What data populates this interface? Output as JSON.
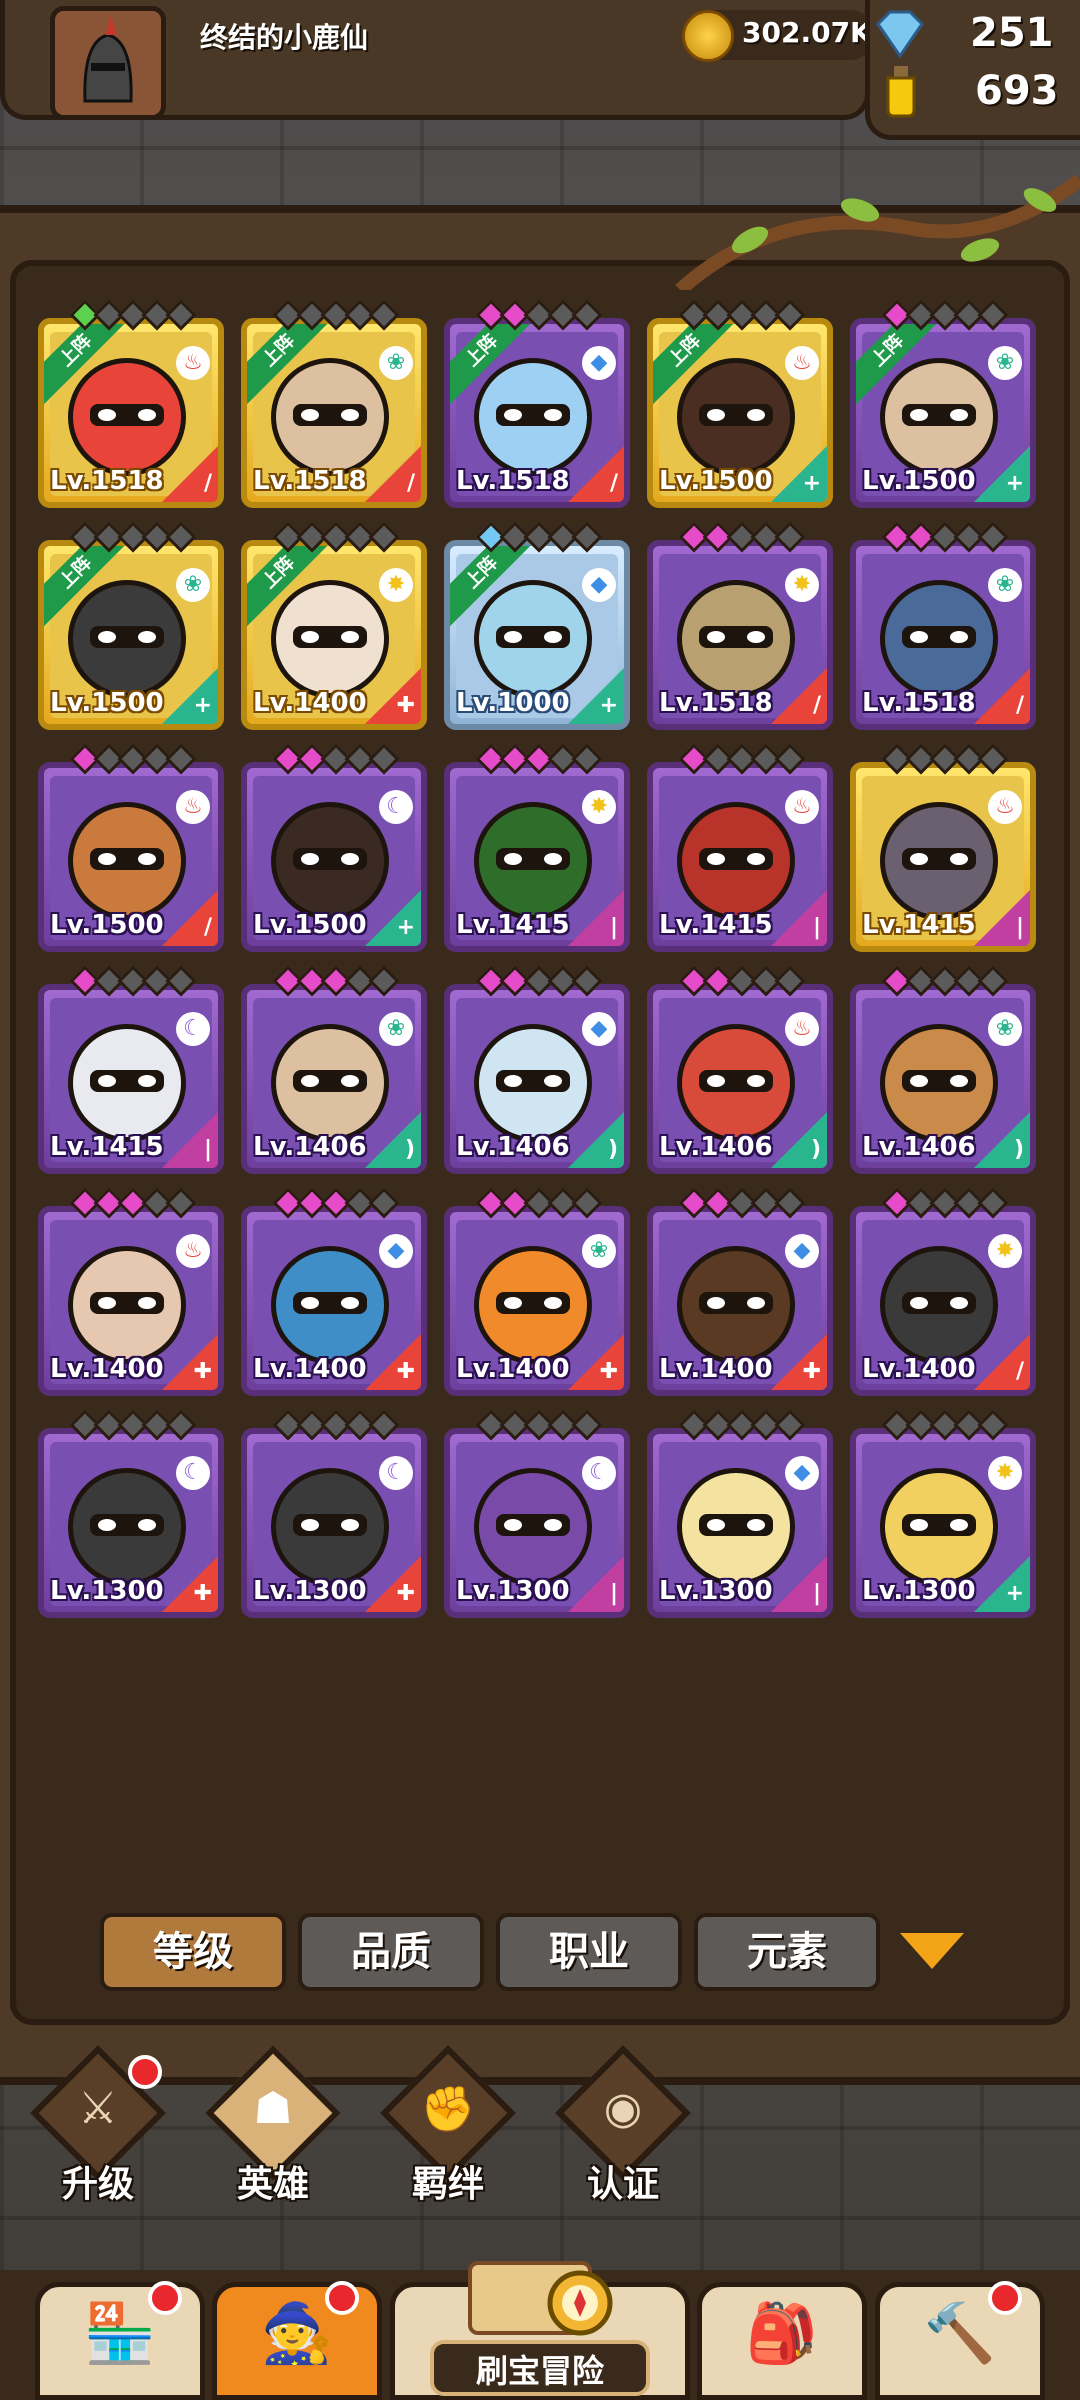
{
  "player": {
    "name": "终结的小鹿仙"
  },
  "resources": {
    "gold": "302.07K",
    "diamonds": "251",
    "potions": "693"
  },
  "heroes": [
    {
      "level": "Lv.1518",
      "rarity": "gold",
      "deployed": true,
      "deployed_label": "上阵",
      "element": "fire",
      "role": "sword",
      "stars": [
        "green",
        "gray",
        "gray",
        "gray",
        "gray"
      ]
    },
    {
      "level": "Lv.1518",
      "rarity": "gold",
      "deployed": true,
      "deployed_label": "上阵",
      "element": "wind",
      "role": "sword",
      "stars": [
        "gray",
        "gray",
        "gray",
        "gray",
        "gray"
      ]
    },
    {
      "level": "Lv.1518",
      "rarity": "purple",
      "deployed": true,
      "deployed_label": "上阵",
      "element": "water",
      "role": "sword",
      "stars": [
        "pink",
        "pink",
        "gray",
        "gray",
        "gray"
      ]
    },
    {
      "level": "Lv.1500",
      "rarity": "gold",
      "deployed": true,
      "deployed_label": "上阵",
      "element": "fire",
      "role": "shield",
      "stars": [
        "gray",
        "gray",
        "gray",
        "gray",
        "gray"
      ]
    },
    {
      "level": "Lv.1500",
      "rarity": "purple",
      "deployed": true,
      "deployed_label": "上阵",
      "element": "wind",
      "role": "shield",
      "stars": [
        "pink",
        "gray",
        "gray",
        "gray",
        "gray"
      ]
    },
    {
      "level": "Lv.1500",
      "rarity": "gold",
      "deployed": true,
      "deployed_label": "上阵",
      "element": "wind",
      "role": "shield",
      "stars": [
        "gray",
        "gray",
        "gray",
        "gray",
        "gray"
      ]
    },
    {
      "level": "Lv.1400",
      "rarity": "gold",
      "deployed": true,
      "deployed_label": "上阵",
      "element": "light",
      "role": "cross",
      "stars": [
        "gray",
        "gray",
        "gray",
        "gray",
        "gray"
      ]
    },
    {
      "level": "Lv.1000",
      "rarity": "silver",
      "deployed": true,
      "deployed_label": "上阵",
      "element": "water",
      "role": "shield",
      "stars": [
        "blue",
        "gray",
        "gray",
        "gray",
        "gray"
      ]
    },
    {
      "level": "Lv.1518",
      "rarity": "purple",
      "deployed": false,
      "element": "light",
      "role": "sword",
      "stars": [
        "pink",
        "pink",
        "gray",
        "gray",
        "gray"
      ]
    },
    {
      "level": "Lv.1518",
      "rarity": "purple",
      "deployed": false,
      "element": "wind",
      "role": "sword",
      "stars": [
        "pink",
        "pink",
        "gray",
        "gray",
        "gray"
      ]
    },
    {
      "level": "Lv.1500",
      "rarity": "purple",
      "deployed": false,
      "element": "fire",
      "role": "sword",
      "stars": [
        "pink",
        "gray",
        "gray",
        "gray",
        "gray"
      ]
    },
    {
      "level": "Lv.1500",
      "rarity": "purple",
      "deployed": false,
      "element": "dark",
      "role": "shield",
      "stars": [
        "pink",
        "pink",
        "gray",
        "gray",
        "gray"
      ]
    },
    {
      "level": "Lv.1415",
      "rarity": "purple",
      "deployed": false,
      "element": "light",
      "role": "staff",
      "stars": [
        "pink",
        "pink",
        "pink",
        "gray",
        "gray"
      ]
    },
    {
      "level": "Lv.1415",
      "rarity": "purple",
      "deployed": false,
      "element": "fire",
      "role": "staff",
      "stars": [
        "pink",
        "gray",
        "gray",
        "gray",
        "gray"
      ]
    },
    {
      "level": "Lv.1415",
      "rarity": "gold",
      "deployed": false,
      "element": "fire",
      "role": "staff",
      "stars": [
        "gray",
        "gray",
        "gray",
        "gray",
        "gray"
      ]
    },
    {
      "level": "Lv.1415",
      "rarity": "purple",
      "deployed": false,
      "element": "dark",
      "role": "staff",
      "stars": [
        "pink",
        "gray",
        "gray",
        "gray",
        "gray"
      ]
    },
    {
      "level": "Lv.1406",
      "rarity": "purple",
      "deployed": false,
      "element": "wind",
      "role": "bow",
      "stars": [
        "pink",
        "pink",
        "pink",
        "gray",
        "gray"
      ]
    },
    {
      "level": "Lv.1406",
      "rarity": "purple",
      "deployed": false,
      "element": "water",
      "role": "bow",
      "stars": [
        "pink",
        "pink",
        "gray",
        "gray",
        "gray"
      ]
    },
    {
      "level": "Lv.1406",
      "rarity": "purple",
      "deployed": false,
      "element": "fire",
      "role": "bow",
      "stars": [
        "pink",
        "pink",
        "gray",
        "gray",
        "gray"
      ]
    },
    {
      "level": "Lv.1406",
      "rarity": "purple",
      "deployed": false,
      "element": "wind",
      "role": "bow",
      "stars": [
        "pink",
        "gray",
        "gray",
        "gray",
        "gray"
      ]
    },
    {
      "level": "Lv.1400",
      "rarity": "purple",
      "deployed": false,
      "element": "fire",
      "role": "cross",
      "stars": [
        "pink",
        "pink",
        "pink",
        "gray",
        "gray"
      ]
    },
    {
      "level": "Lv.1400",
      "rarity": "purple",
      "deployed": false,
      "element": "water",
      "role": "cross",
      "stars": [
        "pink",
        "pink",
        "pink",
        "gray",
        "gray"
      ]
    },
    {
      "level": "Lv.1400",
      "rarity": "purple",
      "deployed": false,
      "element": "wind",
      "role": "cross",
      "stars": [
        "pink",
        "pink",
        "gray",
        "gray",
        "gray"
      ]
    },
    {
      "level": "Lv.1400",
      "rarity": "purple",
      "deployed": false,
      "element": "water",
      "role": "cross",
      "stars": [
        "pink",
        "pink",
        "gray",
        "gray",
        "gray"
      ]
    },
    {
      "level": "Lv.1400",
      "rarity": "purple",
      "deployed": false,
      "element": "light",
      "role": "sword",
      "stars": [
        "pink",
        "gray",
        "gray",
        "gray",
        "gray"
      ]
    },
    {
      "level": "Lv.1300",
      "rarity": "purple",
      "deployed": false,
      "element": "dark",
      "role": "cross",
      "stars": [
        "gray",
        "gray",
        "gray",
        "gray",
        "gray"
      ]
    },
    {
      "level": "Lv.1300",
      "rarity": "purple",
      "deployed": false,
      "element": "dark",
      "role": "cross",
      "stars": [
        "gray",
        "gray",
        "gray",
        "gray",
        "gray"
      ]
    },
    {
      "level": "Lv.1300",
      "rarity": "purple",
      "deployed": false,
      "element": "dark",
      "role": "staff",
      "stars": [
        "gray",
        "gray",
        "gray",
        "gray",
        "gray"
      ]
    },
    {
      "level": "Lv.1300",
      "rarity": "purple",
      "deployed": false,
      "element": "water",
      "role": "staff",
      "stars": [
        "gray",
        "gray",
        "gray",
        "gray",
        "gray"
      ]
    },
    {
      "level": "Lv.1300",
      "rarity": "purple",
      "deployed": false,
      "element": "light",
      "role": "shield",
      "stars": [
        "gray",
        "gray",
        "gray",
        "gray",
        "gray"
      ]
    }
  ],
  "filters": [
    {
      "label": "等级",
      "active": true
    },
    {
      "label": "品质",
      "active": false
    },
    {
      "label": "职业",
      "active": false
    },
    {
      "label": "元素",
      "active": false
    }
  ],
  "actions": [
    {
      "label": "升级",
      "icon": "sword-upgrade-icon",
      "badge": true
    },
    {
      "label": "英雄",
      "icon": "hero-icon",
      "badge": false,
      "selected": true
    },
    {
      "label": "羁绊",
      "icon": "handshake-icon",
      "badge": false
    },
    {
      "label": "认证",
      "icon": "eye-icon",
      "badge": false
    }
  ],
  "bottom_nav": {
    "adventure_label": "刷宝冒险",
    "items": [
      {
        "name": "shop",
        "icon": "shop-icon",
        "badge": true
      },
      {
        "name": "heroes",
        "icon": "hero-avatar-icon",
        "badge": true,
        "selected": true
      },
      {
        "name": "inventory",
        "icon": "backpack-icon",
        "badge": false
      },
      {
        "name": "forge",
        "icon": "hammer-icon",
        "badge": true
      }
    ]
  },
  "colors": {
    "gold_card": "#e5a91e",
    "purple_card": "#7a4fb2",
    "silver_card": "#a9c9e6",
    "active_tab": "#b07a3c",
    "badge": "#e8282d"
  }
}
